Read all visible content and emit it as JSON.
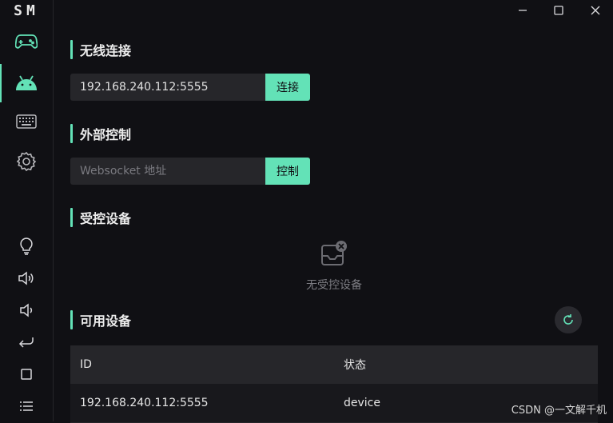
{
  "app": {
    "logo": "SM"
  },
  "sidebar": {
    "top_items": [
      {
        "name": "gamepad",
        "icon": "gamepad-icon",
        "active": false
      },
      {
        "name": "android",
        "icon": "android-icon",
        "active": true
      },
      {
        "name": "keyboard",
        "icon": "keyboard-icon",
        "active": false
      },
      {
        "name": "settings",
        "icon": "gear-icon",
        "active": false
      }
    ],
    "bottom_items": [
      {
        "name": "theme",
        "icon": "lightbulb-icon"
      },
      {
        "name": "volume-up",
        "icon": "volume-up-icon"
      },
      {
        "name": "volume-down",
        "icon": "volume-down-icon"
      },
      {
        "name": "back",
        "icon": "back-icon"
      },
      {
        "name": "home",
        "icon": "square-icon"
      },
      {
        "name": "menu",
        "icon": "list-icon"
      }
    ]
  },
  "window_controls": {
    "minimize": "minimize-icon",
    "maximize": "maximize-icon",
    "close": "close-icon"
  },
  "wireless": {
    "title": "无线连接",
    "input_value": "192.168.240.112:5555",
    "button_label": "连接"
  },
  "external": {
    "title": "外部控制",
    "input_placeholder": "Websocket 地址",
    "button_label": "控制"
  },
  "controlled": {
    "title": "受控设备",
    "empty_text": "无受控设备"
  },
  "available": {
    "title": "可用设备",
    "columns": [
      "ID",
      "状态"
    ],
    "rows": [
      {
        "id": "192.168.240.112:5555",
        "status": "device"
      }
    ]
  },
  "watermark": "CSDN @一文解千机",
  "colors": {
    "accent": "#63e2b7",
    "background": "#101014",
    "input_bg": "#26262a"
  }
}
